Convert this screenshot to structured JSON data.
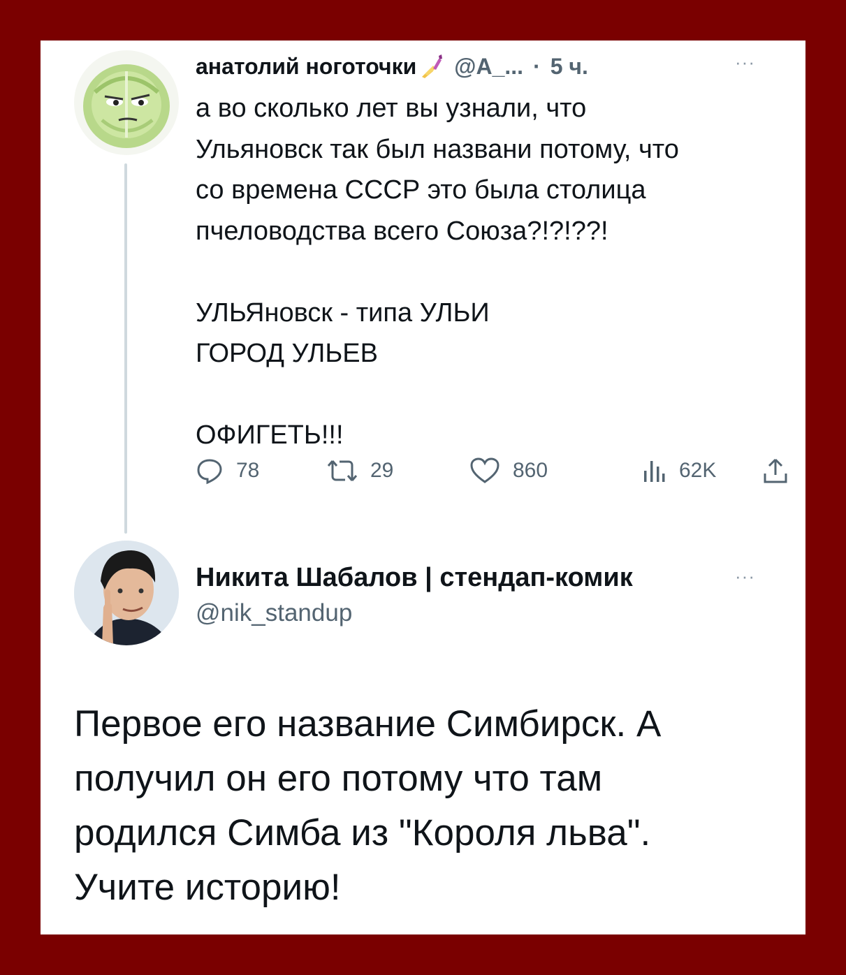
{
  "tweet": {
    "author_name": "анатолий ноготочки",
    "author_emoji": "nail-polish-icon",
    "handle": "@А_...",
    "separator": "·",
    "time": "5 ч.",
    "more": "···",
    "text_lines": [
      "а во сколько лет вы узнали, что",
      "Ульяновск так был названи потому, что",
      "со времена СССР это была столица",
      "пчеловодства всего Союза?!?!??!",
      "",
      "УЛЬЯновск -  типа УЛЬИ",
      "ГОРОД УЛЬЕВ",
      "",
      "ОФИГЕТЬ!!!"
    ],
    "actions": {
      "replies": "78",
      "retweets": "29",
      "likes": "860",
      "views": "62K"
    }
  },
  "reply": {
    "author_name": "Никита Шабалов | стендап-комик",
    "handle": "@nik_standup",
    "more": "···",
    "text_lines": [
      "Первое его название Симбирск. А",
      "получил он его потому что там",
      "родился Симба из \"Короля льва\".",
      "Учите историю!"
    ]
  },
  "colors": {
    "frame": "#7a0000",
    "text": "#0f1419",
    "secondary": "#536471",
    "thread_line": "#cfd9de"
  }
}
